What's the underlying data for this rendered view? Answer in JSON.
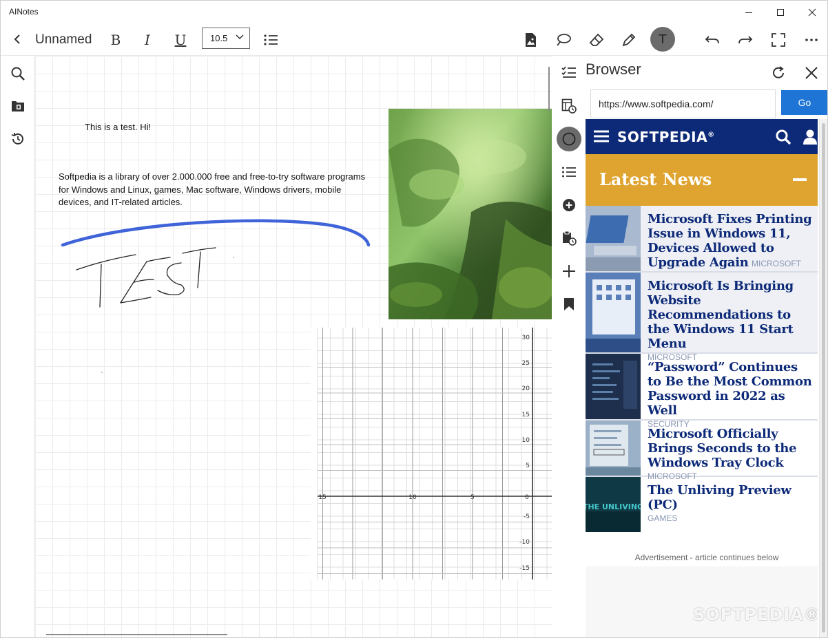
{
  "app": {
    "title": "AINotes"
  },
  "toolbar": {
    "note_title": "Unnamed",
    "bold_label": "B",
    "italic_label": "I",
    "underline_label": "U",
    "font_size": "10.5",
    "avatar_letter": "T"
  },
  "canvas": {
    "line1": "This is a test. Hi!",
    "paragraph": "Softpedia is a library of over 2.000.000 free and free-to-try software programs for Windows and Linux, games, Mac software, Windows drivers, mobile devices, and IT-related articles.",
    "handwriting": "TEST",
    "graph": {
      "y_ticks": [
        "30",
        "25",
        "20",
        "15",
        "10",
        "5",
        "-5",
        "-10",
        "-15"
      ],
      "x_ticks": [
        "15",
        "10",
        "5",
        "0"
      ]
    }
  },
  "browser": {
    "title": "Browser",
    "url": "https://www.softpedia.com/",
    "go_label": "Go",
    "site": {
      "logo": "SOFTPEDIA",
      "logo_mark": "®",
      "section_title": "Latest News",
      "articles": [
        {
          "title": "Microsoft Fixes Printing Issue in Windows 11, Devices Allowed to Upgrade Again",
          "category": "MICROSOFT"
        },
        {
          "title": "Microsoft Is Bringing Website Recommendations to the Windows 11 Start Menu",
          "category": "MICROSOFT"
        },
        {
          "title": "“Password” Continues to Be the Most Common Password in 2022 as Well",
          "category": "SECURITY"
        },
        {
          "title": "Microsoft Officially Brings Seconds to the Windows Tray Clock",
          "category": "MICROSOFT"
        },
        {
          "title": "The Unliving Preview (PC)",
          "category": "GAMES",
          "thumb_text": "THE UNLIVING"
        }
      ],
      "ad_label": "Advertisement - article continues below",
      "watermark": "SOFTPEDIA®"
    }
  },
  "colors": {
    "accent": "#1e75d6",
    "site_header": "#0d2a78",
    "news_bar": "#dea42f",
    "ink_blue": "#3f63d8"
  }
}
